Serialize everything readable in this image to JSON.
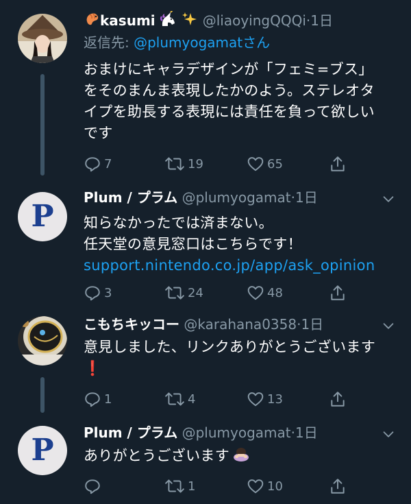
{
  "tweets": [
    {
      "name": "kasumi",
      "handle": "@liaoyingQQQi",
      "dot": "·",
      "time": "1日",
      "reply_prefix": "返信先: ",
      "reply_mention": "@plumyogamat",
      "reply_suffix": "さん",
      "lines": [
        "おまけにキャラデザインが「フェミ=ブス」",
        "をそのまんま表現したかのよう。ステレオタ",
        "イプを助長する表現には責任を負って欲しい",
        "です"
      ],
      "replies": "7",
      "retweets": "19",
      "likes": "65"
    },
    {
      "name": "Plum / プラム",
      "handle": "@plumyogamat",
      "dot": "·",
      "time": "1日",
      "avatar_letter": "P",
      "lines": [
        "知らなかったでは済まない。",
        "任天堂の意見窓口はこちらです！"
      ],
      "link": "support.nintendo.co.jp/app/ask_opinion",
      "replies": "3",
      "retweets": "24",
      "likes": "48"
    },
    {
      "name": "こもちキッコー",
      "handle": "@karahana0358",
      "dot": "·",
      "time": "1日",
      "lines": [
        "意見しました、リンクありがとうございます"
      ],
      "emoji_line": "❗",
      "replies": "1",
      "retweets": "4",
      "likes": "13"
    },
    {
      "name": "Plum / プラム",
      "handle": "@plumyogamat",
      "dot": "·",
      "time": "1日",
      "avatar_letter": "P",
      "text": "ありがとうございます",
      "replies": "",
      "retweets": "1",
      "likes": "10"
    }
  ],
  "colors": {
    "background": "#15202b",
    "secondary_text": "#8899a6",
    "link": "#1da1f2",
    "thread_line": "#3d5466"
  }
}
